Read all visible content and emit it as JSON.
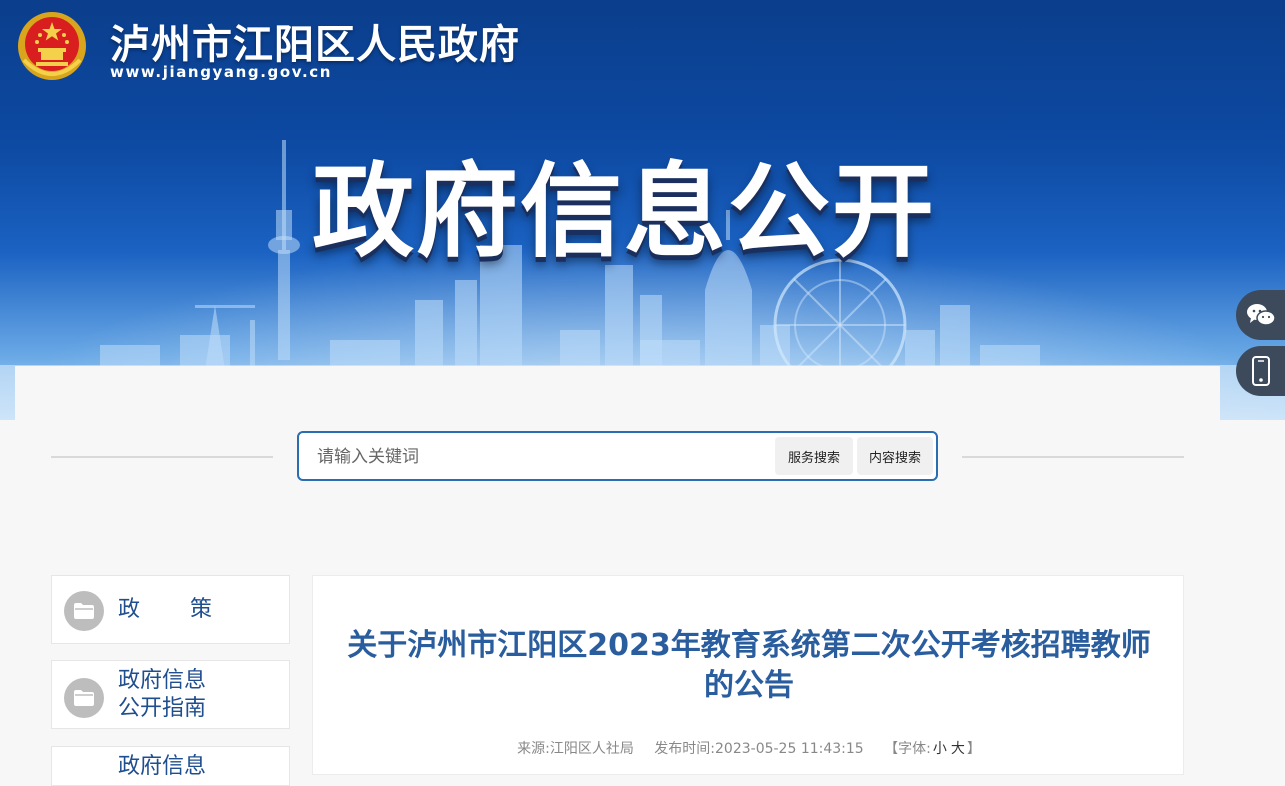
{
  "header": {
    "site_name": "泸州市江阳区人民政府",
    "site_url": "www.jiangyang.gov.cn",
    "banner_title": "政府信息公开"
  },
  "float_buttons": [
    {
      "icon": "wechat-icon"
    },
    {
      "icon": "mobile-icon"
    }
  ],
  "search": {
    "placeholder": "请输入关键词",
    "service_button": "服务搜索",
    "content_button": "内容搜索"
  },
  "sidebar": {
    "items": [
      {
        "label": "政　　策",
        "icon": "folder-open-icon"
      },
      {
        "label": "政府信息\n公开指南",
        "icon": "folder-icon"
      },
      {
        "label": "政府信息"
      }
    ]
  },
  "article": {
    "title": "关于泸州市江阳区2023年教育系统第二次公开考核招聘教师的公告",
    "source": "来源:江阳区人社局",
    "publish_time": "发布时间:2023-05-25 11:43:15",
    "font_label_open": "【字体:",
    "font_small": "小",
    "font_large": "大",
    "font_label_close": "】"
  },
  "colors": {
    "banner_top": "#0b3e8c",
    "accent": "#2a6db0",
    "title_blue": "#2a5d9e",
    "nav_text": "#1f4e8f"
  }
}
